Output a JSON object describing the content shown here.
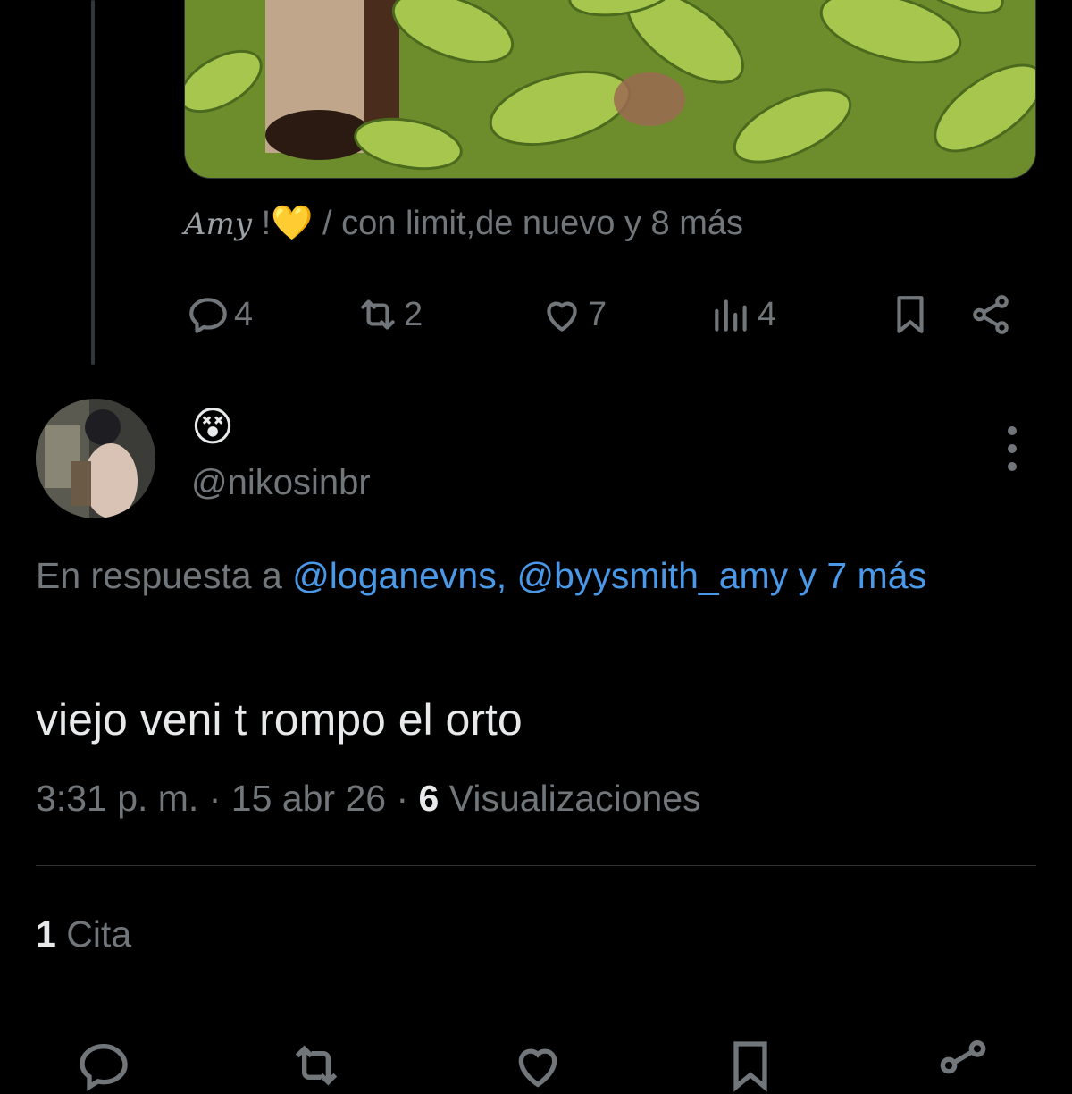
{
  "parent_tweet": {
    "tagged": {
      "name": "Amy",
      "name_suffix": " !",
      "heart_emoji": "💛",
      "rest": " / con limit,de nuevo y 8 más"
    },
    "actions": {
      "replies": "4",
      "retweets": "2",
      "likes": "7",
      "views": "4"
    }
  },
  "reply": {
    "display_name": "😵",
    "handle": "@nikosinbr",
    "in_reply_to_prefix": "En respuesta a ",
    "mentions": "@loganevns, @byysmith_amy y 7 más",
    "text": "viejo veni t rompo el orto",
    "time": "3:31 p. m.",
    "date": "15 abr 26",
    "views_count": "6",
    "views_label": "Visualizaciones"
  },
  "stats": {
    "quotes_count": "1",
    "quotes_label": "Cita"
  },
  "colors": {
    "background": "#000000",
    "text_primary": "#e7e9ea",
    "text_secondary": "#71767b",
    "link": "#4a99e9",
    "divider": "#2f3336"
  }
}
